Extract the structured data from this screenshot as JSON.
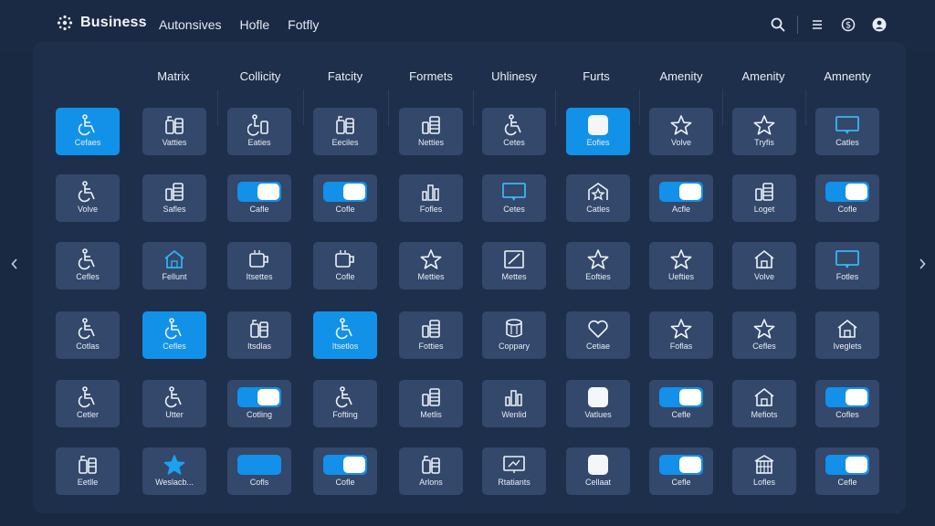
{
  "app": {
    "brand": "Business",
    "nav": [
      "Autonsives",
      "Hofle",
      "Fotfly"
    ],
    "action_icons": [
      "search-icon",
      "menu-icon",
      "dollar-icon",
      "profile-icon"
    ]
  },
  "columns": [
    "Matrix",
    "Collicity",
    "Fatcity",
    "Formets",
    "Uhlinesy",
    "Furts",
    "Amenity",
    "Amenity",
    "Amnenty"
  ],
  "rows": [
    [
      {
        "icon": "wheelchair-icon",
        "label": "Cefaes",
        "active": true
      },
      {
        "icon": "fuel-icon",
        "label": "Vatties"
      },
      {
        "icon": "fuel-wheel-icon",
        "label": "Eaties"
      },
      {
        "icon": "fuel-icon",
        "label": "Eeciles"
      },
      {
        "icon": "document-stack-icon",
        "label": "Netties"
      },
      {
        "icon": "wheelchair-icon",
        "label": "Cetes"
      },
      {
        "icon": "square-icon",
        "label": "Eofies",
        "active": true
      },
      {
        "icon": "star-icon",
        "label": "Volve"
      },
      {
        "icon": "star-icon",
        "label": "Tryfis"
      },
      {
        "icon": "chat-icon",
        "label": "Catles"
      }
    ],
    [
      {
        "icon": "wheelchair-icon",
        "label": "Volve"
      },
      {
        "icon": "document-stack-icon",
        "label": "Safles"
      },
      {
        "icon": "toggle",
        "label": "Cafle"
      },
      {
        "icon": "toggle",
        "label": "Cofle"
      },
      {
        "icon": "barchart-icon",
        "label": "Fofles"
      },
      {
        "icon": "chat-icon",
        "label": "Cetes"
      },
      {
        "icon": "house-star-icon",
        "label": "Catles"
      },
      {
        "icon": "toggle",
        "label": "Acfle"
      },
      {
        "icon": "document-stack-icon",
        "label": "Loget"
      },
      {
        "icon": "toggle",
        "label": "Cofle"
      }
    ],
    [
      {
        "icon": "wheelchair-icon",
        "label": "Cefles"
      },
      {
        "icon": "house-icon",
        "label": "Fellunt"
      },
      {
        "icon": "coffee-icon",
        "label": "Itsettes"
      },
      {
        "icon": "coffee-icon",
        "label": "Cofle"
      },
      {
        "icon": "star-icon",
        "label": "Metties"
      },
      {
        "icon": "edit-box-icon",
        "label": "Mettes"
      },
      {
        "icon": "star-icon",
        "label": "Eofties"
      },
      {
        "icon": "star-icon",
        "label": "Uefties"
      },
      {
        "icon": "house-icon",
        "label": "Volve"
      },
      {
        "icon": "chat-icon",
        "label": "Fotles"
      }
    ],
    [
      {
        "icon": "wheelchair-icon",
        "label": "Cotlas"
      },
      {
        "icon": "wheelchair-icon",
        "label": "Cefles",
        "active": true
      },
      {
        "icon": "fuel-icon",
        "label": "Itsdlas"
      },
      {
        "icon": "wheelchair-icon",
        "label": "Itsetlos",
        "active": true
      },
      {
        "icon": "document-stack-icon",
        "label": "Fotties"
      },
      {
        "icon": "jar-icon",
        "label": "Coppary"
      },
      {
        "icon": "heart-icon",
        "label": "Cetiae"
      },
      {
        "icon": "star-icon",
        "label": "Foflas"
      },
      {
        "icon": "star-icon",
        "label": "Cefles"
      },
      {
        "icon": "house-icon",
        "label": "Iveglets"
      }
    ],
    [
      {
        "icon": "wheelchair-icon",
        "label": "Cetler"
      },
      {
        "icon": "wheelchair-icon",
        "label": "Utter"
      },
      {
        "icon": "toggle",
        "label": "Cotling"
      },
      {
        "icon": "wheelchair-icon",
        "label": "Fofting"
      },
      {
        "icon": "document-stack-icon",
        "label": "Metlis"
      },
      {
        "icon": "barchart-icon",
        "label": "Wenlid"
      },
      {
        "icon": "square-icon",
        "label": "Vatlues"
      },
      {
        "icon": "toggle",
        "label": "Cefle"
      },
      {
        "icon": "house-icon",
        "label": "Mefiots"
      },
      {
        "icon": "toggle",
        "label": "Cofles"
      }
    ],
    [
      {
        "icon": "fuel-icon",
        "label": "Eetlle"
      },
      {
        "icon": "star-icon",
        "label": "Weslacb..."
      },
      {
        "icon": "toggle-full",
        "label": "Cofls"
      },
      {
        "icon": "toggle",
        "label": "Cofle"
      },
      {
        "icon": "fuel-icon",
        "label": "Arlons"
      },
      {
        "icon": "monitor-icon",
        "label": "Rtatiants"
      },
      {
        "icon": "square-icon",
        "label": "Cellaat"
      },
      {
        "icon": "toggle",
        "label": "Cefle"
      },
      {
        "icon": "building-icon",
        "label": "Lofles"
      },
      {
        "icon": "toggle",
        "label": "Cefle"
      }
    ]
  ],
  "colors": {
    "accent": "#1192e8",
    "tile": "#33486a",
    "panel": "#1e2f4b",
    "background": "#1a2942"
  }
}
